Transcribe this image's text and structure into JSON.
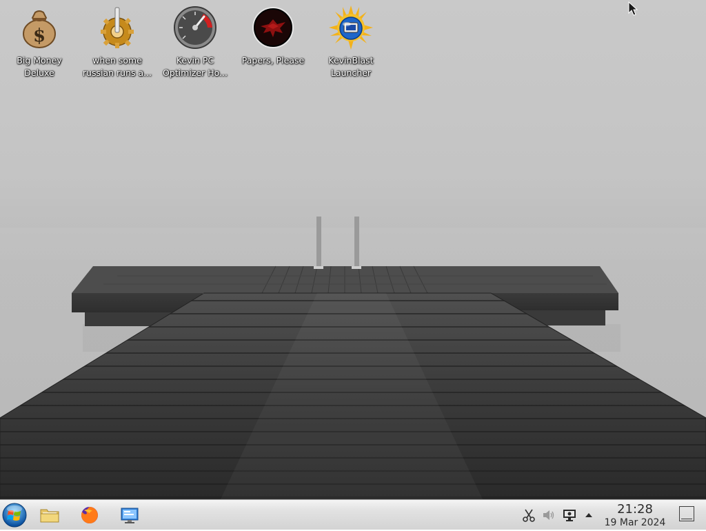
{
  "desktop": {
    "icons": [
      {
        "label_line1": "Big Money",
        "label_line2": "Deluxe",
        "icon": "money-bag-icon"
      },
      {
        "label_line1": "when some",
        "label_line2": "russian runs a...",
        "icon": "gear-lever-icon"
      },
      {
        "label_line1": "Kevin PC",
        "label_line2": "Optimizer Ho...",
        "icon": "speedometer-icon"
      },
      {
        "label_line1": "Papers, Please",
        "label_line2": "",
        "icon": "eagle-emblem-icon"
      },
      {
        "label_line1": "KevinBlast",
        "label_line2": "Launcher",
        "icon": "sun-globe-icon"
      }
    ],
    "wallpaper": "grey-pier-in-fog"
  },
  "taskbar": {
    "start": {
      "icon": "start-orb-icon"
    },
    "launchers": [
      {
        "icon": "folder-icon"
      },
      {
        "icon": "firefox-icon"
      },
      {
        "icon": "remote-desktop-icon"
      }
    ],
    "tray": {
      "icons": [
        "scissors-icon",
        "volume-icon",
        "display-icon",
        "chevron-up-icon"
      ],
      "clock_time": "21:28",
      "clock_date": "19 Mar 2024"
    },
    "show_desktop": {
      "icon": "show-desktop-icon"
    }
  },
  "colors": {
    "desktop_bg": "#c4c4c4",
    "taskbar_bg": "#e2e2e2",
    "label_text": "#ffffff",
    "clock_text": "#2b2b2b"
  }
}
